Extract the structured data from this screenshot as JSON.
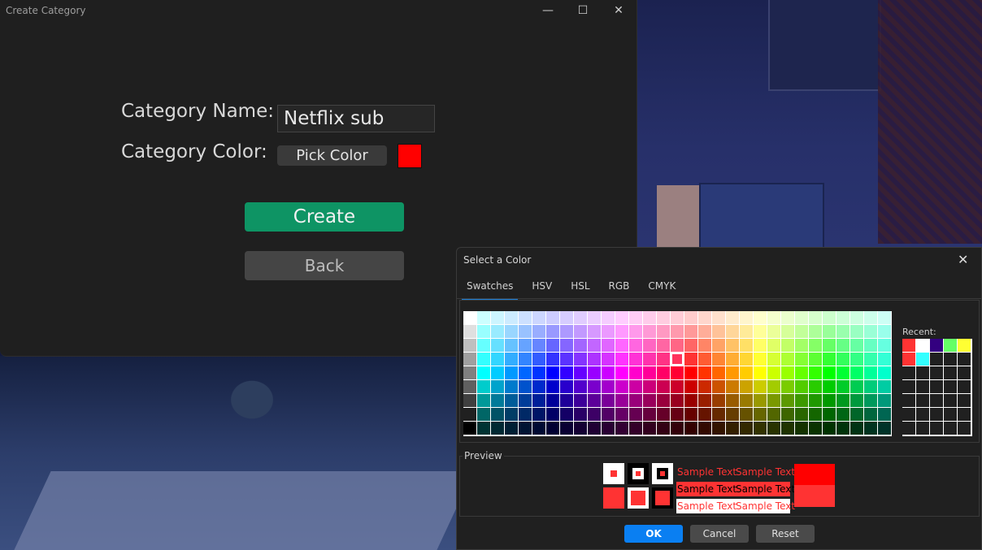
{
  "main_window": {
    "title": "Create Category",
    "minimize_glyph": "—",
    "maximize_glyph": "☐",
    "close_glyph": "✕",
    "name_label": "Category Name:",
    "name_value": "Netflix sub",
    "color_label": "Category Color:",
    "pick_color_label": "Pick Color",
    "selected_color": "#ff0000",
    "create_label": "Create",
    "back_label": "Back"
  },
  "color_dialog": {
    "title": "Select a Color",
    "close_glyph": "✕",
    "tabs": [
      {
        "label": "Swatches",
        "active": true
      },
      {
        "label": "HSV",
        "active": false
      },
      {
        "label": "HSL",
        "active": false
      },
      {
        "label": "RGB",
        "active": false
      },
      {
        "label": "CMYK",
        "active": false
      }
    ],
    "recent_label": "Recent:",
    "recent_colors": [
      "#ff3333",
      "#ffffff",
      "#330080",
      "#66ff66",
      "#ffff33",
      "#ff3333",
      "#33ffff"
    ],
    "preview_label": "Preview",
    "sample_text": "Sample Text",
    "preview_color": "#ff3333",
    "ok_label": "OK",
    "cancel_label": "Cancel",
    "reset_label": "Reset"
  }
}
